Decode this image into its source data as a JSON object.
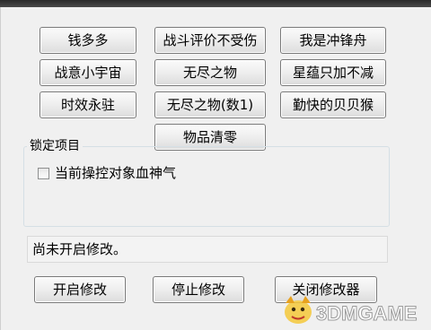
{
  "cheat_buttons": [
    "钱多多",
    "战斗评价不受伤",
    "我是冲锋舟",
    "战意小宇宙",
    "无尽之物",
    "星蕴只加不减",
    "时效永驻",
    "无尽之物(数1)",
    "勤快的贝贝猴",
    "物品清零"
  ],
  "lock_group": {
    "title": "锁定项目",
    "items": [
      {
        "label": "当前操控对象血神气",
        "checked": false
      }
    ]
  },
  "status_text": "尚未开启修改。",
  "controls": {
    "start": "开启修改",
    "stop": "停止修改",
    "close": "关闭修改器"
  },
  "watermark": {
    "text": "3DMGAME"
  }
}
